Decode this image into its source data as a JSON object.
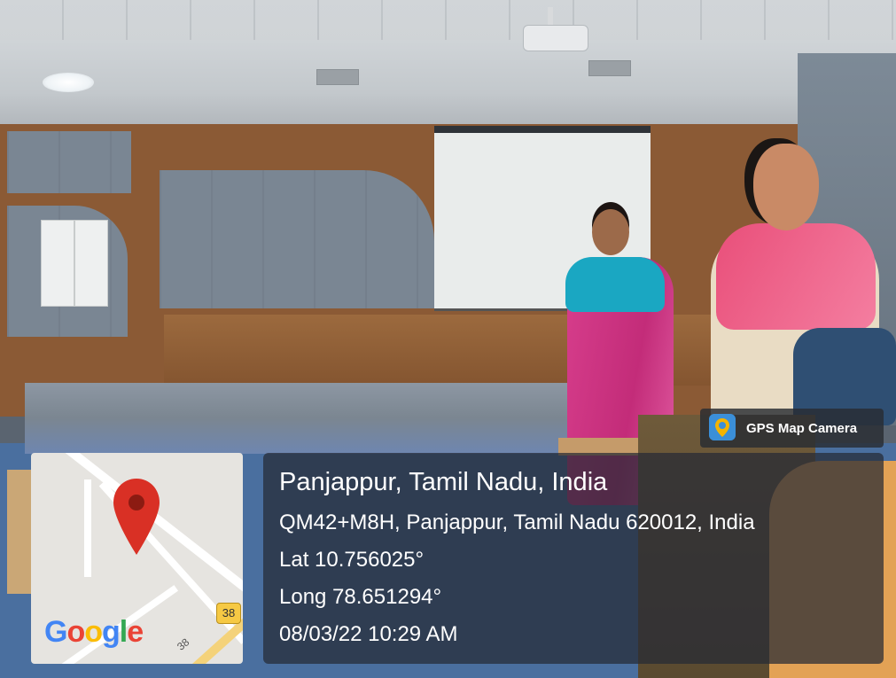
{
  "overlay": {
    "app_badge": "GPS Map Camera",
    "location_title": "Panjappur, Tamil Nadu, India",
    "address": "QM42+M8H, Panjappur, Tamil Nadu 620012, India",
    "latitude": "Lat 10.756025°",
    "longitude": "Long 78.651294°",
    "datetime": "08/03/22 10:29 AM"
  },
  "map": {
    "logo_text": "Google",
    "road_badge": "38",
    "road_number": "38",
    "pin_color": "#d93025",
    "logo_colors": [
      "#4285F4",
      "#EA4335",
      "#FBBC05",
      "#4285F4",
      "#34A853",
      "#EA4335"
    ]
  }
}
